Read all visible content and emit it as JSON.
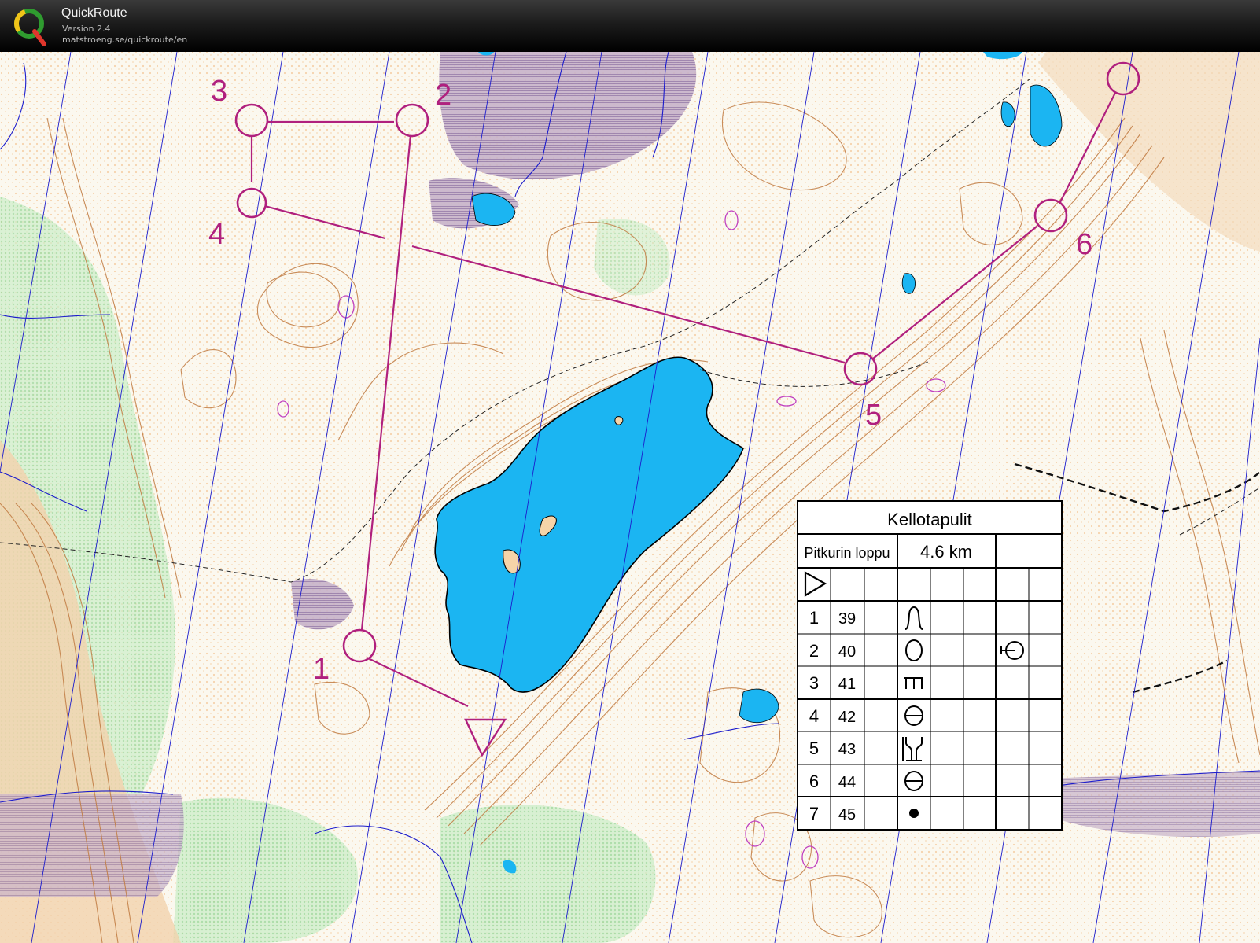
{
  "app": {
    "name": "QuickRoute",
    "version": "Version 2.4",
    "url": "matstroeng.se/quickroute/en"
  },
  "colors": {
    "course": "#b0207e",
    "water": "#1bb5f2",
    "marsh": "#b898b8",
    "contour": "#c07a40",
    "vegetation": "#8fd48f",
    "yellow": "#f6d4a8",
    "north_lines": "#1c1ccc"
  },
  "course": {
    "start_symbol": "triangle-icon",
    "controls": [
      {
        "label": "1"
      },
      {
        "label": "2"
      },
      {
        "label": "3"
      },
      {
        "label": "4"
      },
      {
        "label": "5"
      },
      {
        "label": "6"
      }
    ]
  },
  "description": {
    "title": "Kellotapulit",
    "class": "Pitkurin loppu",
    "length": "4.6 km",
    "rows": [
      {
        "n": "1",
        "code": "39",
        "feature": "knoll-icon",
        "detail": ""
      },
      {
        "n": "2",
        "code": "40",
        "feature": "depression-icon",
        "detail": "control-foot-icon"
      },
      {
        "n": "3",
        "code": "41",
        "feature": "cliff-icon",
        "detail": ""
      },
      {
        "n": "4",
        "code": "42",
        "feature": "hill-icon",
        "detail": ""
      },
      {
        "n": "5",
        "code": "43",
        "feature": "spur-icon",
        "detail": ""
      },
      {
        "n": "6",
        "code": "44",
        "feature": "hill-icon",
        "detail": ""
      },
      {
        "n": "7",
        "code": "45",
        "feature": "boulder-icon",
        "detail": ""
      }
    ]
  }
}
